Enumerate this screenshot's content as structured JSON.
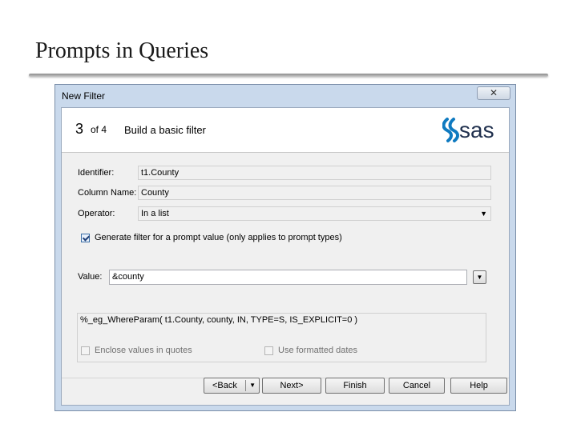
{
  "slide": {
    "title": "Prompts in Queries"
  },
  "dialog": {
    "title": "New Filter",
    "close_glyph": "✕",
    "step": {
      "number": "3",
      "of": "of 4",
      "title": "Build a basic filter"
    },
    "logo_text": "sas",
    "fields": {
      "identifier_label": "Identifier:",
      "identifier_value": "t1.County",
      "column_label": "Column Name:",
      "column_value": "County",
      "operator_label": "Operator:",
      "operator_value": "In a list"
    },
    "generate_checkbox": {
      "checked": true,
      "label": "Generate filter for a prompt value (only applies to prompt types)"
    },
    "value": {
      "label": "Value:",
      "text": "&county"
    },
    "expression": "%_eg_WhereParam( t1.County, county, IN, TYPE=S, IS_EXPLICIT=0 )",
    "enclose_checkbox": {
      "checked": false,
      "label": "Enclose values in quotes"
    },
    "formatted_checkbox": {
      "checked": false,
      "label": "Use formatted dates"
    },
    "buttons": {
      "back": "<Back",
      "next": "Next>",
      "finish": "Finish",
      "cancel": "Cancel",
      "help": "Help"
    }
  },
  "colors": {
    "frame": "#c9d9ec",
    "sas_blue": "#0f7ac0",
    "sas_dark": "#1f2f4d"
  }
}
